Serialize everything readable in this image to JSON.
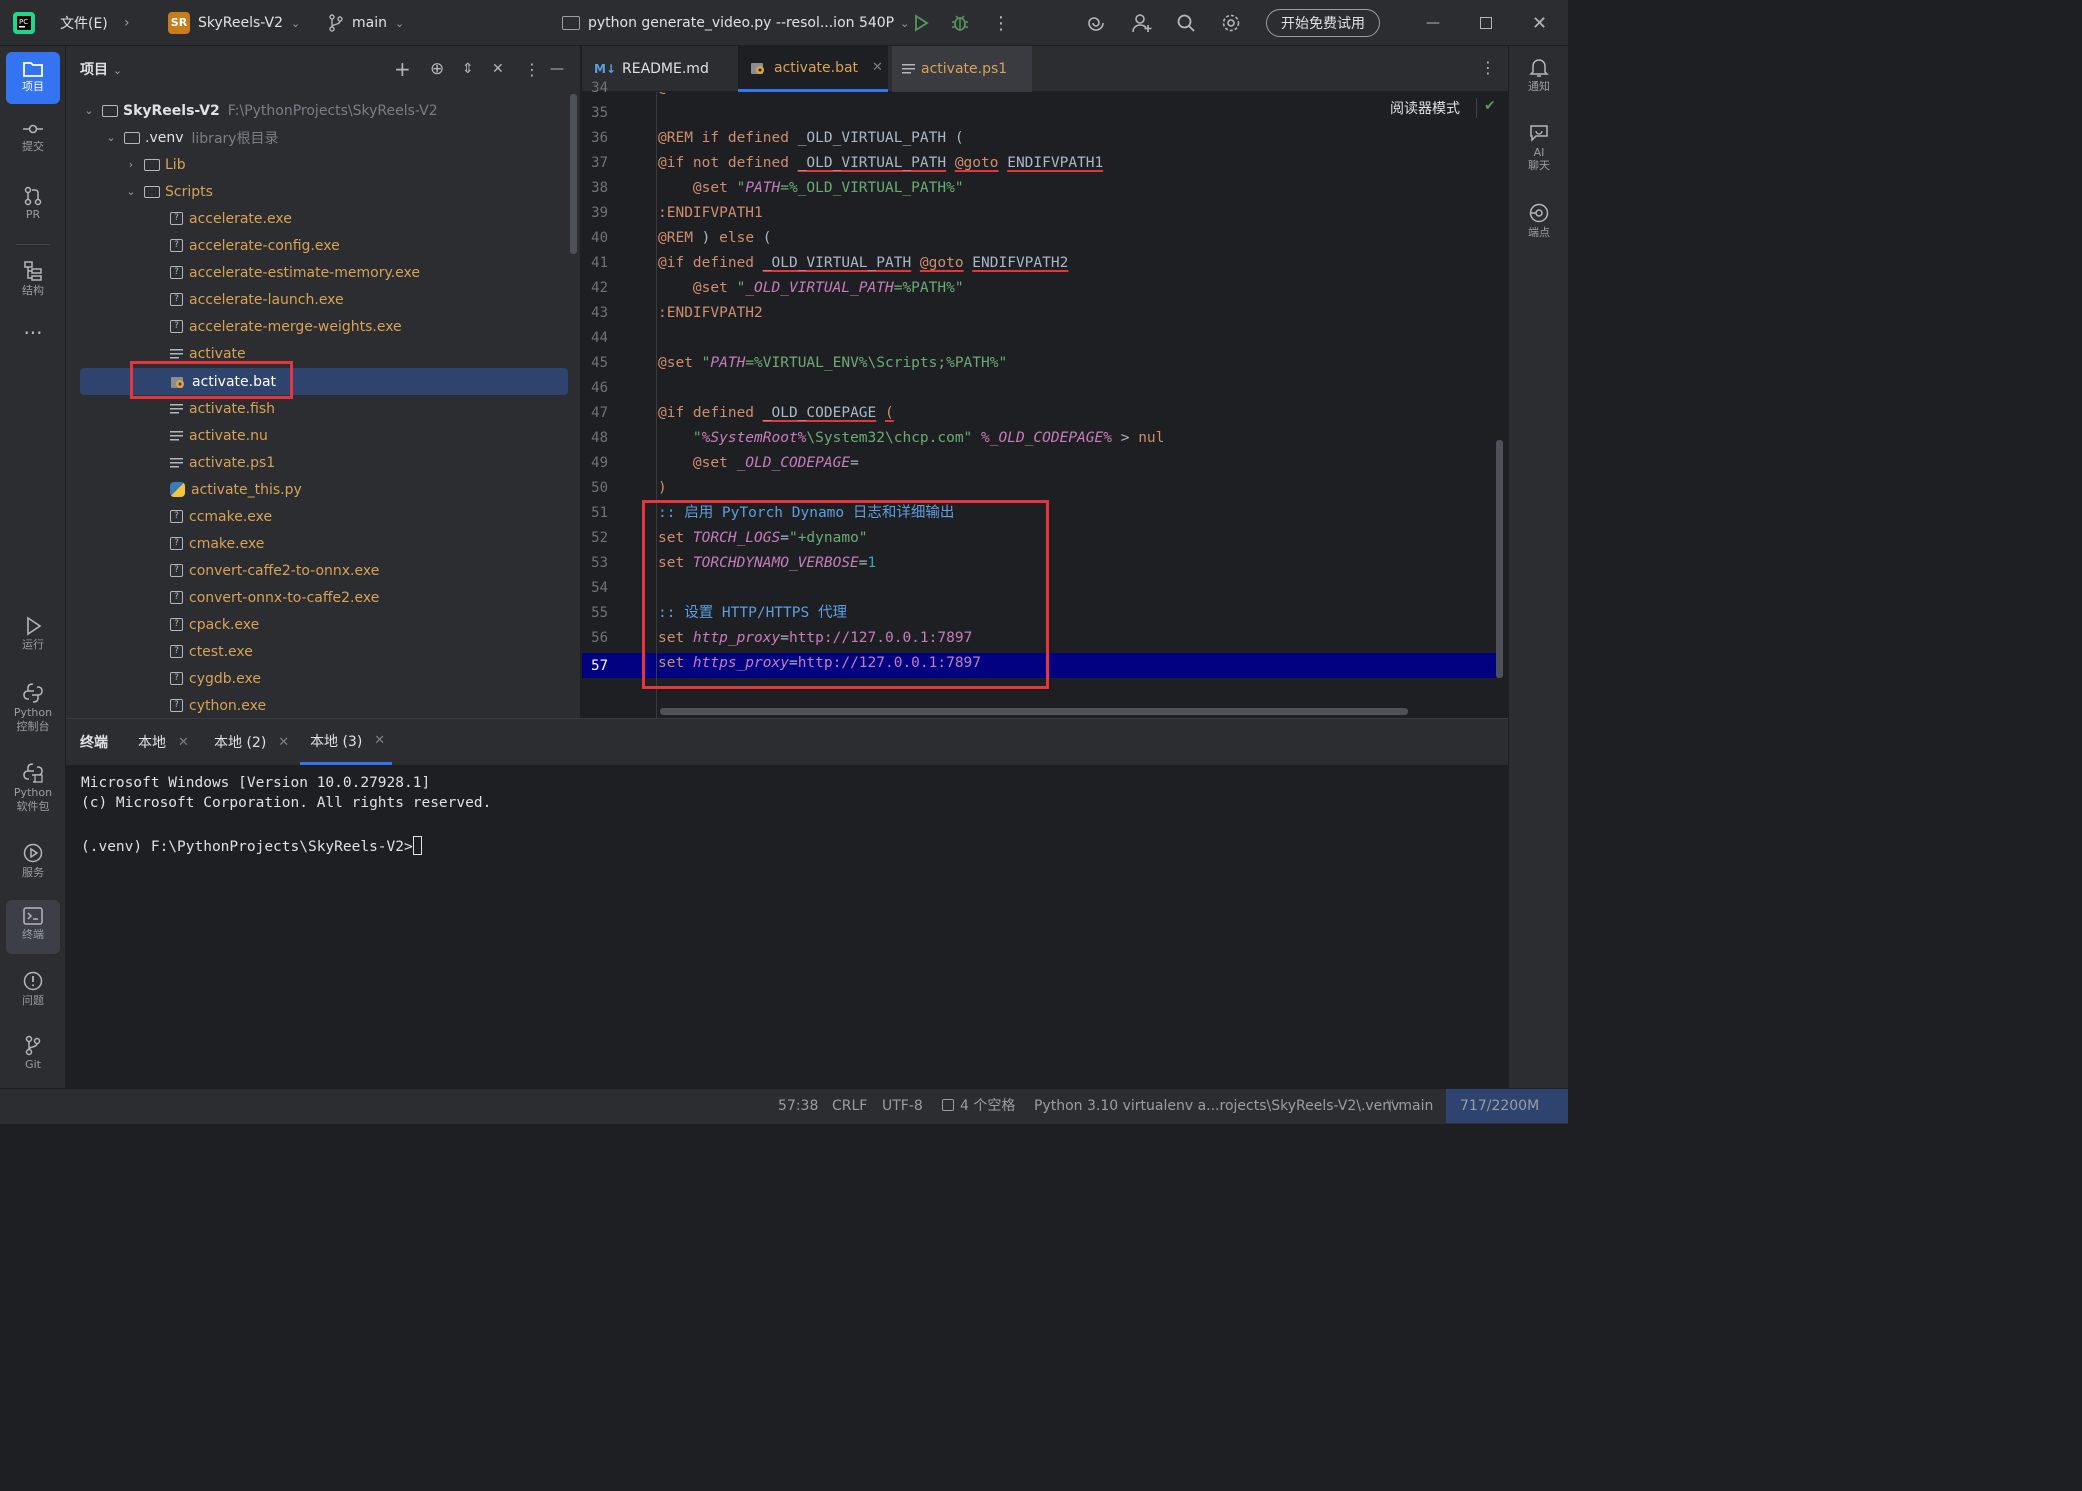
{
  "titlebar": {
    "file_menu": "文件(E)",
    "project_badge": "SR",
    "project_name": "SkyReels-V2",
    "branch": "main",
    "run_config": "python generate_video.py --resol...ion 540P",
    "trial_button": "开始免费试用"
  },
  "left_tools": {
    "project": "项目",
    "commit": "提交",
    "pr": "PR",
    "structure": "结构",
    "run": "运行",
    "python_console_1": "Python",
    "python_console_2": "控制台",
    "python_packages_1": "Python",
    "python_packages_2": "软件包",
    "services": "服务",
    "terminal": "终端",
    "problems": "问题",
    "git": "Git"
  },
  "right_tools": {
    "notifications": "通知",
    "ai_chat_1": "AI",
    "ai_chat_2": "聊天",
    "endpoints": "端点"
  },
  "project_panel": {
    "title": "项目",
    "tree": [
      {
        "name": "SkyReels-V2",
        "extra": "F:\\PythonProjects\\SkyReels-V2",
        "icon": "folder-icon"
      },
      {
        "name": ".venv",
        "extra": "library根目录",
        "icon": "folder-icon"
      },
      {
        "name": "Lib",
        "extra": "",
        "icon": "folder-icon"
      },
      {
        "name": "Scripts",
        "extra": "",
        "icon": "folder-icon"
      },
      {
        "name": "accelerate.exe",
        "icon": "unknown-file-icon"
      },
      {
        "name": "accelerate-config.exe",
        "icon": "unknown-file-icon"
      },
      {
        "name": "accelerate-estimate-memory.exe",
        "icon": "unknown-file-icon"
      },
      {
        "name": "accelerate-launch.exe",
        "icon": "unknown-file-icon"
      },
      {
        "name": "accelerate-merge-weights.exe",
        "icon": "unknown-file-icon"
      },
      {
        "name": "activate",
        "icon": "text-file-icon"
      },
      {
        "name": "activate.bat",
        "icon": "bat-file-icon"
      },
      {
        "name": "activate.fish",
        "icon": "text-file-icon"
      },
      {
        "name": "activate.nu",
        "icon": "text-file-icon"
      },
      {
        "name": "activate.ps1",
        "icon": "text-file-icon"
      },
      {
        "name": "activate_this.py",
        "icon": "python-file-icon"
      },
      {
        "name": "ccmake.exe",
        "icon": "unknown-file-icon"
      },
      {
        "name": "cmake.exe",
        "icon": "unknown-file-icon"
      },
      {
        "name": "convert-caffe2-to-onnx.exe",
        "icon": "unknown-file-icon"
      },
      {
        "name": "convert-onnx-to-caffe2.exe",
        "icon": "unknown-file-icon"
      },
      {
        "name": "cpack.exe",
        "icon": "unknown-file-icon"
      },
      {
        "name": "ctest.exe",
        "icon": "unknown-file-icon"
      },
      {
        "name": "cygdb.exe",
        "icon": "unknown-file-icon"
      },
      {
        "name": "cython.exe",
        "icon": "unknown-file-icon"
      }
    ]
  },
  "editor": {
    "tabs": [
      {
        "label": "README.md",
        "icon_text": "M↓"
      },
      {
        "label": "activate.bat",
        "active": true
      },
      {
        "label": "activate.ps1"
      }
    ],
    "reader_mode": "阅读器模式",
    "line_numbers": [
      "34",
      "35",
      "36",
      "37",
      "38",
      "39",
      "40",
      "41",
      "42",
      "43",
      "44",
      "45",
      "46",
      "47",
      "48",
      "49",
      "50",
      "51",
      "52",
      "53",
      "54",
      "55",
      "56",
      "57"
    ],
    "current_line": "57"
  },
  "terminal": {
    "title": "终端",
    "tabs": [
      "本地",
      "本地 (2)",
      "本地 (3)"
    ],
    "lines": [
      "Microsoft Windows [Version 10.0.27928.1]",
      "(c) Microsoft Corporation. All rights reserved.",
      "",
      "(.venv) F:\\PythonProjects\\SkyReels-V2>"
    ]
  },
  "statusbar": {
    "caret": "57:38",
    "line_sep": "CRLF",
    "encoding": "UTF-8",
    "indent": "4 个空格",
    "interpreter": "Python 3.10 virtualenv a...rojects\\SkyReels-V2\\.venv",
    "branch": "main",
    "memory": "717/2200M"
  },
  "colors": {
    "accent": "#3574f0",
    "highlight_box": "#e5363d",
    "selected_row": "#2e436e",
    "current_line": "#000080"
  }
}
